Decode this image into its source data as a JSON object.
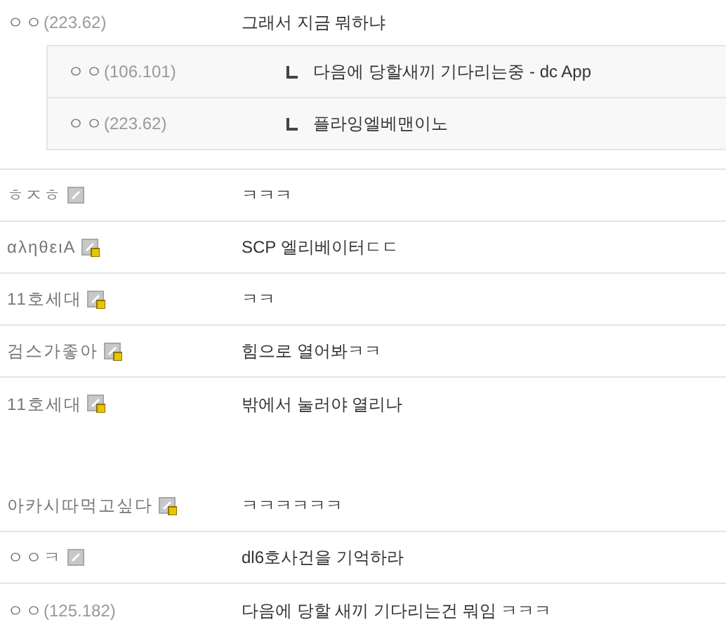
{
  "comments": [
    {
      "kind": "guest",
      "nick": "ㅇㅇ",
      "ip": "(223.62)",
      "text": "그래서 지금 뭐하냐",
      "replies": [
        {
          "nick": "ㅇㅇ",
          "ip": "(106.101)",
          "text": "다음에 당할새끼 기다리는중 - dc App"
        },
        {
          "nick": "ㅇㅇ",
          "ip": "(223.62)",
          "text": "플라잉엘베맨이노"
        }
      ]
    },
    {
      "kind": "fixed",
      "nick": "ㅎㅈㅎ",
      "text": "ㅋㅋㅋ"
    },
    {
      "kind": "half_fixed",
      "nick": "αληθειA",
      "text": "SCP 엘리베이터ㄷㄷ"
    },
    {
      "kind": "half_fixed",
      "nick": "11호세대",
      "text": "ㅋㅋ"
    },
    {
      "kind": "half_fixed",
      "nick": "검스가좋아",
      "text": "힘으로 열어봐ㅋㅋ"
    },
    {
      "kind": "half_fixed",
      "nick": "11호세대",
      "text": "밖에서 눌러야 열리나"
    }
  ],
  "later_comments": [
    {
      "kind": "half_fixed",
      "nick": "아카시따먹고싶다",
      "text": "ㅋㅋㅋㅋㅋㅋ"
    },
    {
      "kind": "fixed",
      "nick": "ㅇㅇㅋ",
      "text": "dl6호사건을 기억하라"
    },
    {
      "kind": "guest",
      "nick": "ㅇㅇ",
      "ip": "(125.182)",
      "text": "다음에 당할 새끼 기다리는건 뭐임 ㅋㅋㅋ"
    }
  ]
}
